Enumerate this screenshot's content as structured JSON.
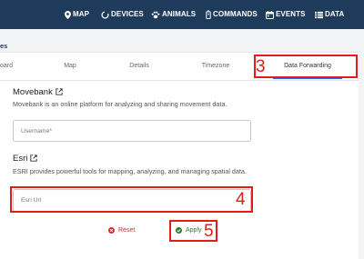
{
  "nav": {
    "items": [
      {
        "label": "MAP",
        "icon": "map-pin-icon"
      },
      {
        "label": "DEVICES",
        "icon": "devices-icon"
      },
      {
        "label": "ANIMALS",
        "icon": "paw-icon"
      },
      {
        "label": "COMMANDS",
        "icon": "remote-icon"
      },
      {
        "label": "EVENTS",
        "icon": "calendar-icon"
      },
      {
        "label": "DATA",
        "icon": "data-list-icon"
      }
    ]
  },
  "page": {
    "title_fragment": "es"
  },
  "tabs": [
    {
      "label": "oard"
    },
    {
      "label": "Map"
    },
    {
      "label": "Details"
    },
    {
      "label": "Timezone"
    },
    {
      "label": "Data Forwarding",
      "active": true
    }
  ],
  "movebank": {
    "title": "Movebank",
    "description": "Movebank is an online platform for analyzing and sharing movement data.",
    "username_placeholder": "Username*"
  },
  "esri": {
    "title": "Esri",
    "description": "ESRI provides powerful tools for mapping, analyzing, and managing spatial data.",
    "url_placeholder": "Esri Url"
  },
  "actions": {
    "reset_label": "Reset",
    "apply_label": "Apply"
  },
  "annotations": {
    "tab_marker": "3",
    "field_marker": "4",
    "apply_marker": "5"
  },
  "colors": {
    "topbar": "#1f3b5c",
    "accent": "#1f6feb",
    "reset": "#d32f2f",
    "apply": "#2e7d32",
    "highlight": "#e21b1b"
  }
}
